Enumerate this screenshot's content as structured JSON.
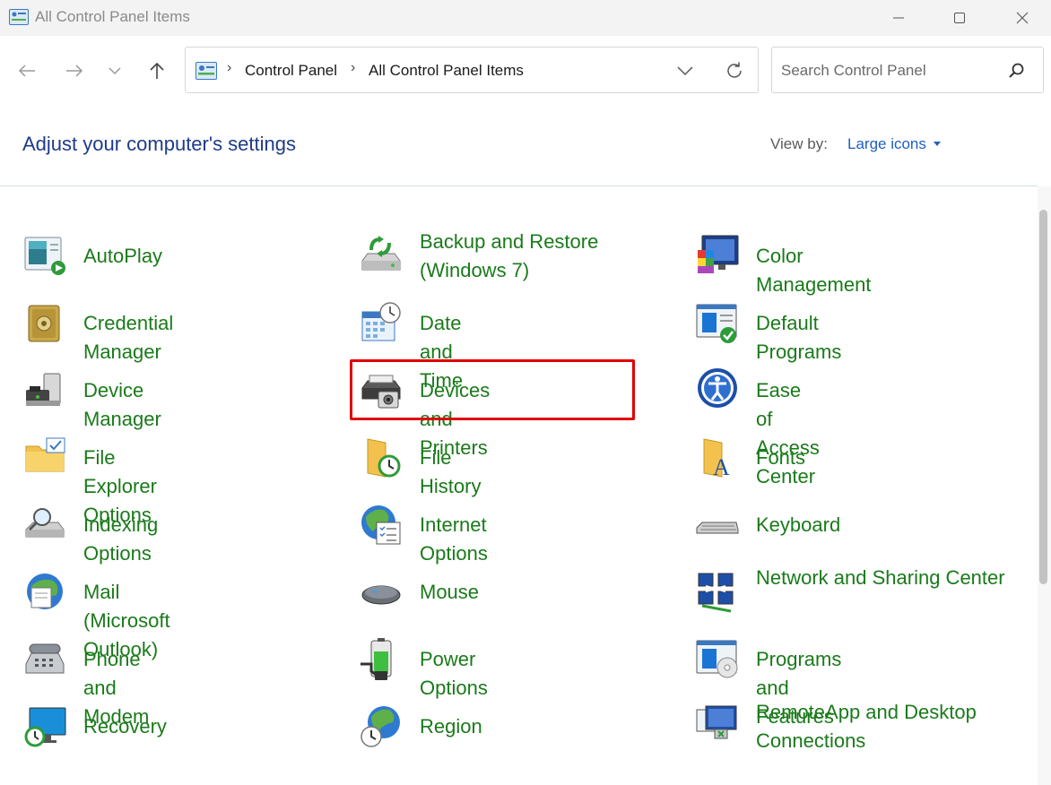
{
  "window": {
    "title": "All Control Panel Items",
    "controls": [
      "minimize",
      "maximize",
      "close"
    ]
  },
  "nav": {
    "back": "back-arrow-icon",
    "forward": "forward-arrow-icon",
    "recent": "chevron-down-icon",
    "up": "up-arrow-icon"
  },
  "address": {
    "crumbs": [
      "Control Panel",
      "All Control Panel Items"
    ],
    "separator": "›"
  },
  "search": {
    "placeholder": "Search Control Panel"
  },
  "header": {
    "title": "Adjust your computer's settings",
    "view_by_label": "View by:",
    "view_by_value": "Large icons"
  },
  "colors": {
    "link_green": "#1a7a1a",
    "heading_blue": "#1e3a8a",
    "highlight_red": "#e00000"
  },
  "items": [
    {
      "label": "AutoPlay",
      "icon": "autoplay-icon"
    },
    {
      "label": "Backup and Restore (Windows 7)",
      "icon": "backup-restore-icon"
    },
    {
      "label": "Color Management",
      "icon": "color-management-icon"
    },
    {
      "label": "Credential Manager",
      "icon": "credential-manager-icon"
    },
    {
      "label": "Date and Time",
      "icon": "date-time-icon"
    },
    {
      "label": "Default Programs",
      "icon": "default-programs-icon"
    },
    {
      "label": "Device Manager",
      "icon": "device-manager-icon"
    },
    {
      "label": "Devices and Printers",
      "icon": "devices-printers-icon",
      "highlighted": true
    },
    {
      "label": "Ease of Access Center",
      "icon": "ease-of-access-icon"
    },
    {
      "label": "File Explorer Options",
      "icon": "file-explorer-options-icon"
    },
    {
      "label": "File History",
      "icon": "file-history-icon"
    },
    {
      "label": "Fonts",
      "icon": "fonts-icon"
    },
    {
      "label": "Indexing Options",
      "icon": "indexing-options-icon"
    },
    {
      "label": "Internet Options",
      "icon": "internet-options-icon"
    },
    {
      "label": "Keyboard",
      "icon": "keyboard-icon"
    },
    {
      "label": "Mail (Microsoft Outlook)",
      "icon": "mail-icon"
    },
    {
      "label": "Mouse",
      "icon": "mouse-icon"
    },
    {
      "label": "Network and Sharing Center",
      "icon": "network-sharing-icon"
    },
    {
      "label": "Phone and Modem",
      "icon": "phone-modem-icon"
    },
    {
      "label": "Power Options",
      "icon": "power-options-icon"
    },
    {
      "label": "Programs and Features",
      "icon": "programs-features-icon"
    },
    {
      "label": "Recovery",
      "icon": "recovery-icon"
    },
    {
      "label": "Region",
      "icon": "region-icon"
    },
    {
      "label": "RemoteApp and Desktop Connections",
      "icon": "remoteapp-icon"
    }
  ]
}
